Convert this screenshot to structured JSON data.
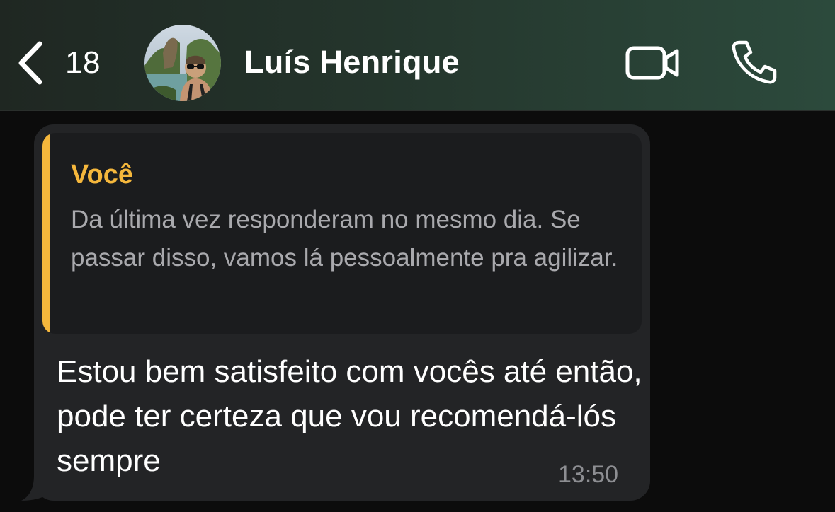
{
  "header": {
    "back_count": "18",
    "contact_name": "Luís Henrique",
    "icons": {
      "back": "chevron-left-icon",
      "video": "video-camera-icon",
      "call": "phone-icon"
    },
    "colors": {
      "gradient_start": "#1f2722",
      "gradient_end": "#2c4a3c"
    }
  },
  "message": {
    "reply": {
      "author": "Você",
      "text": "Da última vez responderam no mesmo dia. Se passar disso, vamos lá pessoalmente pra agilizar."
    },
    "text": "Estou bem satisfeito com vocês até então, pode ter certeza que vou recomendá-lós sempre",
    "time": "13:50"
  },
  "colors": {
    "accent": "#f5b73c",
    "bubble": "#232426",
    "quote_background": "#1b1c1e",
    "background": "#0c0c0c"
  }
}
